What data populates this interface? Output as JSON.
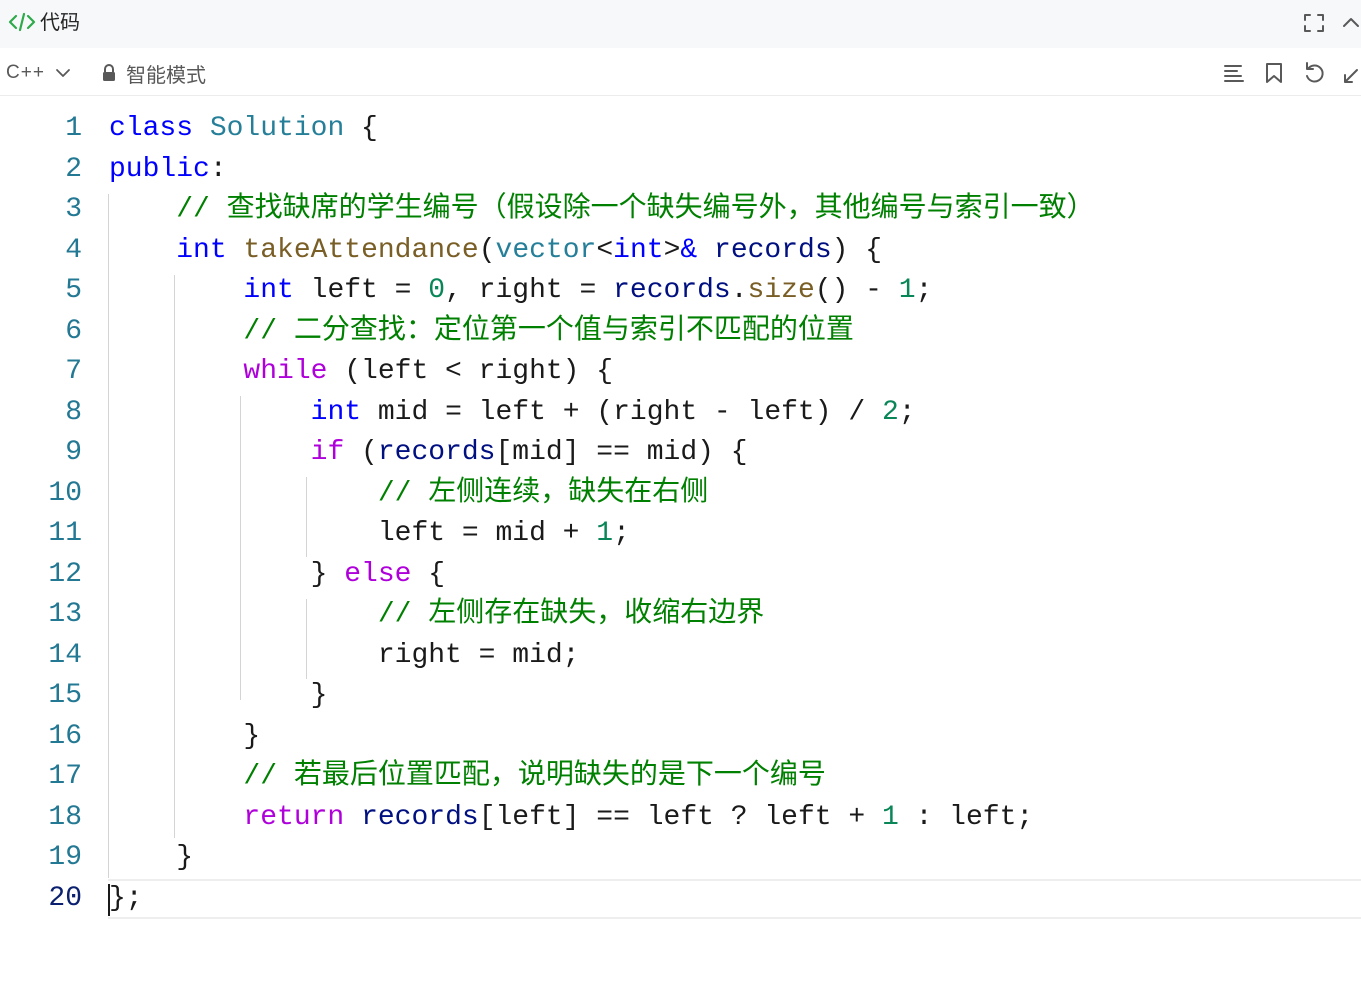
{
  "window": {
    "title": "代码"
  },
  "toolbar": {
    "language": "C++",
    "mode_label": "智能模式"
  },
  "editor": {
    "active_line": 20,
    "lines": [
      {
        "number": "1",
        "tokens": [
          {
            "c": "kw",
            "t": "class"
          },
          {
            "c": "pl",
            "t": " "
          },
          {
            "c": "ty",
            "t": "Solution"
          },
          {
            "c": "pl",
            "t": " {"
          }
        ]
      },
      {
        "number": "2",
        "tokens": [
          {
            "c": "kw",
            "t": "public"
          },
          {
            "c": "pl",
            "t": ":"
          }
        ]
      },
      {
        "number": "3",
        "tokens": [
          {
            "c": "pl",
            "t": "    "
          },
          {
            "c": "cm",
            "t": "// 查找缺席的学生编号（假设除一个缺失编号外，其他编号与索引一致）"
          }
        ]
      },
      {
        "number": "4",
        "tokens": [
          {
            "c": "pl",
            "t": "    "
          },
          {
            "c": "kw",
            "t": "int"
          },
          {
            "c": "pl",
            "t": " "
          },
          {
            "c": "fn",
            "t": "takeAttendance"
          },
          {
            "c": "pl",
            "t": "("
          },
          {
            "c": "ty",
            "t": "vector"
          },
          {
            "c": "pl",
            "t": "<"
          },
          {
            "c": "kw",
            "t": "int"
          },
          {
            "c": "pl",
            "t": ">"
          },
          {
            "c": "kw",
            "t": "&"
          },
          {
            "c": "pl",
            "t": " "
          },
          {
            "c": "vr",
            "t": "records"
          },
          {
            "c": "pl",
            "t": ") {"
          }
        ]
      },
      {
        "number": "5",
        "tokens": [
          {
            "c": "pl",
            "t": "        "
          },
          {
            "c": "kw",
            "t": "int"
          },
          {
            "c": "pl",
            "t": " left = "
          },
          {
            "c": "nm",
            "t": "0"
          },
          {
            "c": "pl",
            "t": ", right = "
          },
          {
            "c": "vr",
            "t": "records"
          },
          {
            "c": "pl",
            "t": "."
          },
          {
            "c": "fn",
            "t": "size"
          },
          {
            "c": "pl",
            "t": "() - "
          },
          {
            "c": "nm",
            "t": "1"
          },
          {
            "c": "pl",
            "t": ";"
          }
        ]
      },
      {
        "number": "6",
        "tokens": [
          {
            "c": "pl",
            "t": "        "
          },
          {
            "c": "cm",
            "t": "// 二分查找：定位第一个值与索引不匹配的位置"
          }
        ]
      },
      {
        "number": "7",
        "tokens": [
          {
            "c": "pl",
            "t": "        "
          },
          {
            "c": "kw2",
            "t": "while"
          },
          {
            "c": "pl",
            "t": " (left < right) {"
          }
        ]
      },
      {
        "number": "8",
        "tokens": [
          {
            "c": "pl",
            "t": "            "
          },
          {
            "c": "kw",
            "t": "int"
          },
          {
            "c": "pl",
            "t": " mid = left + (right - left) / "
          },
          {
            "c": "nm",
            "t": "2"
          },
          {
            "c": "pl",
            "t": ";"
          }
        ]
      },
      {
        "number": "9",
        "tokens": [
          {
            "c": "pl",
            "t": "            "
          },
          {
            "c": "kw2",
            "t": "if"
          },
          {
            "c": "pl",
            "t": " ("
          },
          {
            "c": "vr",
            "t": "records"
          },
          {
            "c": "pl",
            "t": "[mid] == mid) {"
          }
        ]
      },
      {
        "number": "10",
        "tokens": [
          {
            "c": "pl",
            "t": "                "
          },
          {
            "c": "cm",
            "t": "// 左侧连续，缺失在右侧"
          }
        ]
      },
      {
        "number": "11",
        "tokens": [
          {
            "c": "pl",
            "t": "                left = mid + "
          },
          {
            "c": "nm",
            "t": "1"
          },
          {
            "c": "pl",
            "t": ";"
          }
        ]
      },
      {
        "number": "12",
        "tokens": [
          {
            "c": "pl",
            "t": "            } "
          },
          {
            "c": "kw2",
            "t": "else"
          },
          {
            "c": "pl",
            "t": " {"
          }
        ]
      },
      {
        "number": "13",
        "tokens": [
          {
            "c": "pl",
            "t": "                "
          },
          {
            "c": "cm",
            "t": "// 左侧存在缺失，收缩右边界"
          }
        ]
      },
      {
        "number": "14",
        "tokens": [
          {
            "c": "pl",
            "t": "                right = mid;"
          }
        ]
      },
      {
        "number": "15",
        "tokens": [
          {
            "c": "pl",
            "t": "            }"
          }
        ]
      },
      {
        "number": "16",
        "tokens": [
          {
            "c": "pl",
            "t": "        }"
          }
        ]
      },
      {
        "number": "17",
        "tokens": [
          {
            "c": "pl",
            "t": "        "
          },
          {
            "c": "cm",
            "t": "// 若最后位置匹配，说明缺失的是下一个编号"
          }
        ]
      },
      {
        "number": "18",
        "tokens": [
          {
            "c": "pl",
            "t": "        "
          },
          {
            "c": "kw2",
            "t": "return"
          },
          {
            "c": "pl",
            "t": " "
          },
          {
            "c": "vr",
            "t": "records"
          },
          {
            "c": "pl",
            "t": "[left] == left ? left + "
          },
          {
            "c": "nm",
            "t": "1"
          },
          {
            "c": "pl",
            "t": " : left;"
          }
        ]
      },
      {
        "number": "19",
        "tokens": [
          {
            "c": "pl",
            "t": "    }"
          }
        ]
      },
      {
        "number": "20",
        "tokens": [
          {
            "c": "pl",
            "t": "};"
          }
        ]
      }
    ]
  },
  "icons": {
    "title": "code-brackets-icon",
    "fullscreen": "fullscreen-icon",
    "collapse": "chevron-up-icon",
    "language_dropdown": "chevron-down-icon",
    "lock": "lock-icon",
    "format": "format-lines-icon",
    "bookmark": "bookmark-icon",
    "undo": "undo-icon",
    "expand": "expand-icon"
  },
  "colors": {
    "keyword": "#0000ff",
    "control_keyword": "#af00db",
    "type": "#267f99",
    "function": "#795e26",
    "variable": "#001080",
    "number": "#098658",
    "comment": "#008000",
    "line_number": "#237893",
    "title_icon": "#2eaa4a"
  }
}
